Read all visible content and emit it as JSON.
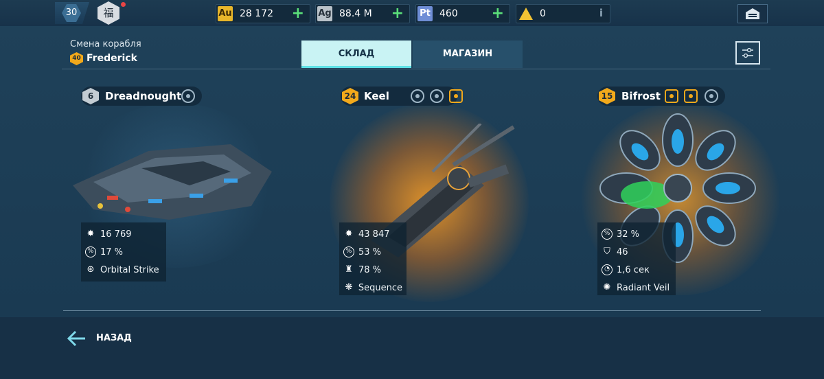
{
  "header": {
    "player_level": "30",
    "emblem_glyph": "福",
    "resources": [
      {
        "tag": "Au",
        "value": "28 172",
        "color": "#e8b62a",
        "icon": "gold-icon"
      },
      {
        "tag": "Ag",
        "value": "88.4 M",
        "color": "#b9c2c9",
        "icon": "silver-icon"
      },
      {
        "tag": "Pt",
        "value": "460",
        "color": "#6f8ed6",
        "icon": "platinum-icon"
      },
      {
        "tag": "",
        "value": "0",
        "color": "#f2c233",
        "icon": "warning-icon"
      }
    ],
    "plus_symbol": "+",
    "info_symbol": "i"
  },
  "pilot": {
    "subtitle": "Смена корабля",
    "level": "40",
    "name": "Frederick"
  },
  "tabs": [
    {
      "label": "СКЛАД",
      "active": true
    },
    {
      "label": "МАГАЗИН",
      "active": false
    }
  ],
  "ships": [
    {
      "rank": "6",
      "name": "Dreadnought",
      "stats": [
        {
          "icon": "firepower-icon",
          "value": "16 769"
        },
        {
          "icon": "percent-icon",
          "value": "17 %"
        },
        {
          "icon": "orbital-strike-icon",
          "value": "Orbital Strike"
        }
      ]
    },
    {
      "rank": "24",
      "name": "Keel",
      "stats": [
        {
          "icon": "firepower-icon",
          "value": "43 847"
        },
        {
          "icon": "percent-icon",
          "value": "53 %"
        },
        {
          "icon": "drones-icon",
          "value": "78 %"
        },
        {
          "icon": "sequence-icon",
          "value": "Sequence"
        }
      ]
    },
    {
      "rank": "15",
      "name": "Bifrost",
      "stats": [
        {
          "icon": "percent-icon",
          "value": "32 %"
        },
        {
          "icon": "armor-icon",
          "value": "46"
        },
        {
          "icon": "timer-icon",
          "value": "1,6 сек"
        },
        {
          "icon": "radiant-veil-icon",
          "value": "Radiant Veil"
        }
      ]
    }
  ],
  "footer": {
    "back_label": "НАЗАД"
  },
  "colors": {
    "accent": "#5fe1e6",
    "gold": "#f2a91b",
    "plus": "#5be07a"
  }
}
